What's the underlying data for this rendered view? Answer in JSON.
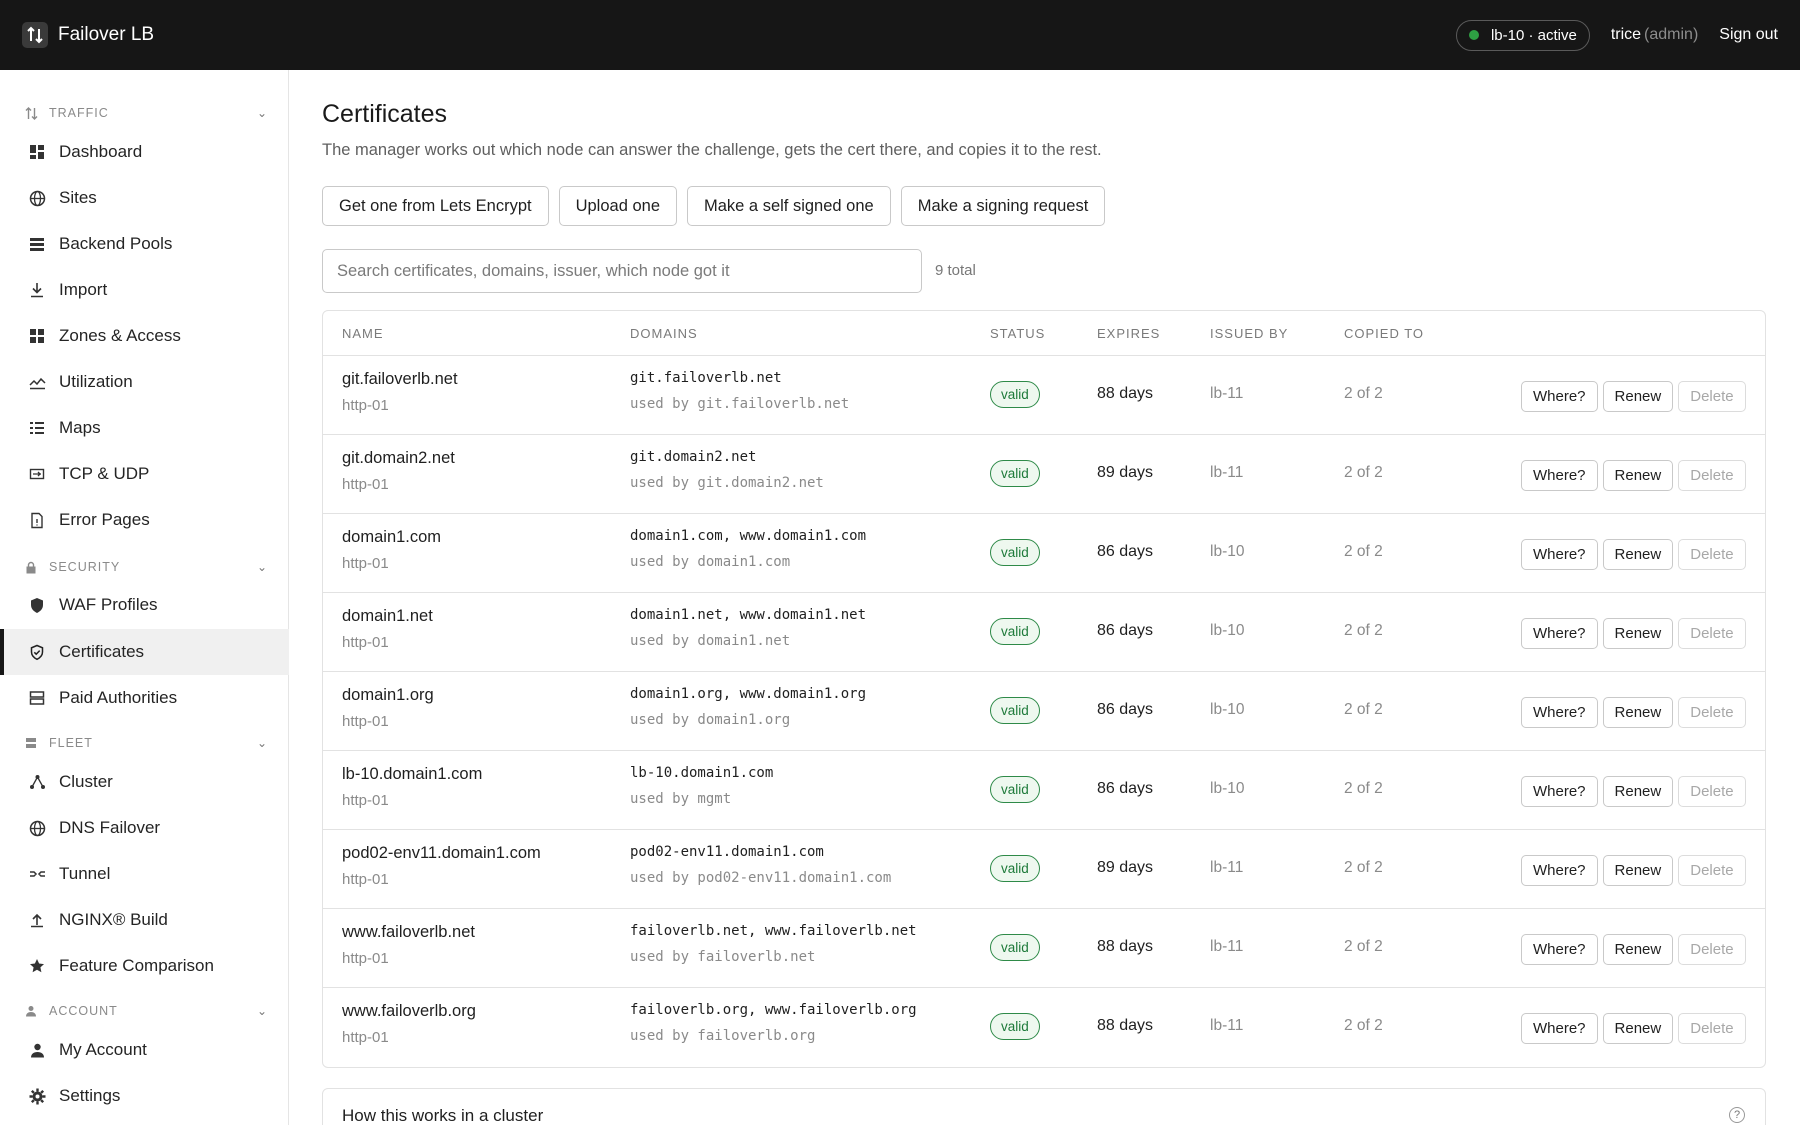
{
  "app": {
    "title": "Failover LB"
  },
  "header": {
    "node_status": "lb-10 · active",
    "user_name": "trice",
    "user_role": "(admin)",
    "signout_label": "Sign out",
    "status_color": "#2ea043"
  },
  "sidebar": {
    "sections": [
      {
        "label": "TRAFFIC",
        "icon": "arrows-updown-icon"
      },
      {
        "label": "SECURITY",
        "icon": "lock-icon"
      },
      {
        "label": "FLEET",
        "icon": "server-icon"
      },
      {
        "label": "ACCOUNT",
        "icon": "user-icon"
      }
    ],
    "items": [
      {
        "label": "Dashboard",
        "icon": "dashboard-icon"
      },
      {
        "label": "Sites",
        "icon": "globe-icon"
      },
      {
        "label": "Backend Pools",
        "icon": "stack-icon"
      },
      {
        "label": "Import",
        "icon": "download-icon"
      },
      {
        "label": "Zones & Access",
        "icon": "grid-icon"
      },
      {
        "label": "Utilization",
        "icon": "chart-icon"
      },
      {
        "label": "Maps",
        "icon": "list-icon"
      },
      {
        "label": "TCP & UDP",
        "icon": "port-icon"
      },
      {
        "label": "Error Pages",
        "icon": "file-icon"
      },
      {
        "label": "WAF Profiles",
        "icon": "shield-icon"
      },
      {
        "label": "Certificates",
        "icon": "shield-check-icon",
        "active": true
      },
      {
        "label": "Paid Authorities",
        "icon": "server-icon"
      },
      {
        "label": "Cluster",
        "icon": "cluster-icon"
      },
      {
        "label": "DNS Failover",
        "icon": "globe-icon"
      },
      {
        "label": "Tunnel",
        "icon": "tunnel-icon"
      },
      {
        "label": "NGINX® Build",
        "icon": "upload-icon"
      },
      {
        "label": "Feature Comparison",
        "icon": "star-icon"
      },
      {
        "label": "My Account",
        "icon": "person-icon"
      },
      {
        "label": "Settings",
        "icon": "gear-icon"
      }
    ]
  },
  "main": {
    "title": "Certificates",
    "subtitle": "The manager works out which node can answer the challenge, gets the cert there, and copies it to the rest.",
    "actions": [
      "Get one from Lets Encrypt",
      "Upload one",
      "Make a self signed one",
      "Make a signing request"
    ],
    "search_placeholder": "Search certificates, domains, issuer, which node got it",
    "total": "9 total",
    "columns": [
      "NAME",
      "DOMAINS",
      "STATUS",
      "EXPIRES",
      "ISSUED BY",
      "COPIED TO"
    ],
    "row_actions": {
      "where": "Where?",
      "renew": "Renew",
      "delete": "Delete"
    },
    "rows": [
      {
        "name": "git.failoverlb.net",
        "method": "http-01",
        "domains": "git.failoverlb.net",
        "used_by": "used by git.failoverlb.net",
        "status": "valid",
        "expires": "88 days",
        "issued_by": "lb-11",
        "copied_to": "2 of 2"
      },
      {
        "name": "git.domain2.net",
        "method": "http-01",
        "domains": "git.domain2.net",
        "used_by": "used by git.domain2.net",
        "status": "valid",
        "expires": "89 days",
        "issued_by": "lb-11",
        "copied_to": "2 of 2"
      },
      {
        "name": "domain1.com",
        "method": "http-01",
        "domains": "domain1.com, www.domain1.com",
        "used_by": "used by domain1.com",
        "status": "valid",
        "expires": "86 days",
        "issued_by": "lb-10",
        "copied_to": "2 of 2"
      },
      {
        "name": "domain1.net",
        "method": "http-01",
        "domains": "domain1.net, www.domain1.net",
        "used_by": "used by domain1.net",
        "status": "valid",
        "expires": "86 days",
        "issued_by": "lb-10",
        "copied_to": "2 of 2"
      },
      {
        "name": "domain1.org",
        "method": "http-01",
        "domains": "domain1.org, www.domain1.org",
        "used_by": "used by domain1.org",
        "status": "valid",
        "expires": "86 days",
        "issued_by": "lb-10",
        "copied_to": "2 of 2"
      },
      {
        "name": "lb-10.domain1.com",
        "method": "http-01",
        "domains": "lb-10.domain1.com",
        "used_by": "used by mgmt",
        "status": "valid",
        "expires": "86 days",
        "issued_by": "lb-10",
        "copied_to": "2 of 2"
      },
      {
        "name": "pod02-env11.domain1.com",
        "method": "http-01",
        "domains": "pod02-env11.domain1.com",
        "used_by": "used by pod02-env11.domain1.com",
        "status": "valid",
        "expires": "89 days",
        "issued_by": "lb-11",
        "copied_to": "2 of 2"
      },
      {
        "name": "www.failoverlb.net",
        "method": "http-01",
        "domains": "failoverlb.net, www.failoverlb.net",
        "used_by": "used by failoverlb.net",
        "status": "valid",
        "expires": "88 days",
        "issued_by": "lb-11",
        "copied_to": "2 of 2"
      },
      {
        "name": "www.failoverlb.org",
        "method": "http-01",
        "domains": "failoverlb.org, www.failoverlb.org",
        "used_by": "used by failoverlb.org",
        "status": "valid",
        "expires": "88 days",
        "issued_by": "lb-11",
        "copied_to": "2 of 2"
      }
    ],
    "info_title": "How this works in a cluster",
    "help_glyph": "?"
  }
}
